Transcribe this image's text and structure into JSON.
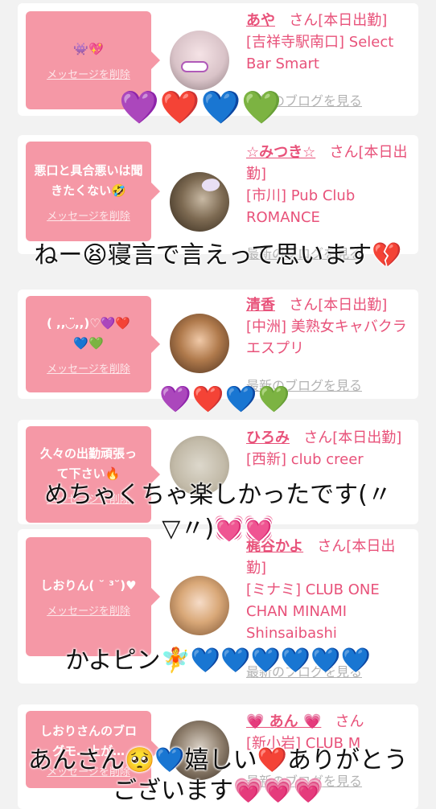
{
  "delete_label": "メッセージを削除",
  "blog_label": "最新のブログを見る",
  "san_label": "さん",
  "cards": [
    {
      "msg": "👾💖",
      "name": "あや",
      "status": "[本日出勤]",
      "shop": "[吉祥寺駅南口] Select Bar Smart"
    },
    {
      "msg": "悪口と具合悪いは聞きたくない🤣",
      "name": "☆みつき☆",
      "status": "[本日出勤]",
      "shop": "[市川] Pub Club ROMANCE"
    },
    {
      "msg": "( ,,◡̈,,)♡💜❤️💙💚",
      "name": "清香",
      "status": "[本日出勤]",
      "shop": "[中洲] 美熟女キャバクラ エスプリ"
    },
    {
      "msg": "久々の出勤頑張って下さい🔥",
      "name": "ひろみ",
      "status": "[本日出勤]",
      "shop": "[西新] club creer"
    },
    {
      "msg": "しおりん( ˘ ³˘)♥",
      "name": "梶谷かよ",
      "status": "[本日出勤]",
      "shop": "[ミナミ] CLUB ONE CHAN MINAMI Shinsaibashi"
    },
    {
      "msg": "しおりさんのブログモ…上が…",
      "name": "💗 あん 💗",
      "status": "",
      "shop": "[新小岩] CLUB M"
    }
  ],
  "overlays": {
    "hearts1": "💜❤️💙💚",
    "text2": "ねー😫寝言で言えって思います💔",
    "hearts3": "💜❤️💙💚",
    "text4a": "めちゃくちゃ楽しかったです(〃",
    "text4b": "▽〃)💓💓",
    "text5": "かよピン🧚💙💙💙💙💙💙",
    "text6a": "あんさん🥺💙嬉しい❤️ありがとう",
    "text6b": "ございます💗💗💗"
  }
}
